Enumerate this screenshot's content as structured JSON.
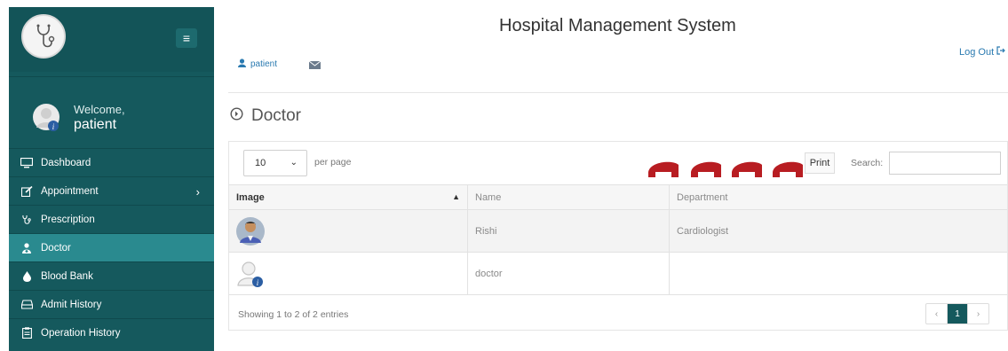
{
  "header": {
    "title": "Hospital Management System",
    "logout_label": "Log Out",
    "user_label": "patient"
  },
  "sidebar": {
    "welcome": "Welcome,",
    "username": "patient",
    "items": [
      {
        "label": "Dashboard",
        "icon": "monitor-icon"
      },
      {
        "label": "Appointment",
        "icon": "edit-icon"
      },
      {
        "label": "Prescription",
        "icon": "stethoscope-icon"
      },
      {
        "label": "Doctor",
        "icon": "user-md-icon"
      },
      {
        "label": "Blood Bank",
        "icon": "drop-icon"
      },
      {
        "label": "Admit History",
        "icon": "hdd-icon"
      },
      {
        "label": "Operation History",
        "icon": "clipboard-icon"
      }
    ],
    "active_item": "Doctor"
  },
  "page": {
    "title": "Doctor"
  },
  "table_controls": {
    "page_length": "10",
    "per_page_label": "per page",
    "print_label": "Print",
    "search_label": "Search:",
    "search_value": ""
  },
  "table": {
    "columns": [
      "Image",
      "Name",
      "Department"
    ],
    "rows": [
      {
        "image": "photo-avatar",
        "name": "Rishi",
        "department": "Cardiologist"
      },
      {
        "image": "default-user-avatar",
        "name": "doctor",
        "department": ""
      }
    ],
    "info": "Showing 1 to 2 of 2 entries"
  },
  "pagination": {
    "prev": "‹",
    "current": "1",
    "next": "›"
  },
  "colors": {
    "sidebar": "#15595d",
    "sidebar_active": "#2a8a8f",
    "link": "#2a7ab0"
  }
}
